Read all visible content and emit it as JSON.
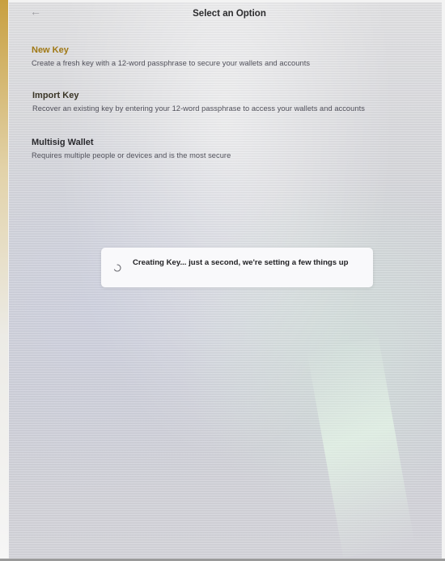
{
  "header": {
    "back_icon": "arrow-left-icon",
    "title": "Select an Option"
  },
  "options": [
    {
      "title": "New Key",
      "description": "Create a fresh key with a 12-word passphrase to secure your wallets and accounts",
      "title_color": "#a07814"
    },
    {
      "title": "Import Key",
      "description": "Recover an existing key by entering your 12-word passphrase to access your wallets and accounts"
    },
    {
      "title": "Multisig Wallet",
      "description": "Requires multiple people or devices and is the most secure"
    }
  ],
  "toast": {
    "icon": "spinner-icon",
    "message": "Creating Key... just a second, we're setting a few things up"
  },
  "colors": {
    "accent": "#a07814",
    "toast_bg": "#f9f9fb"
  }
}
